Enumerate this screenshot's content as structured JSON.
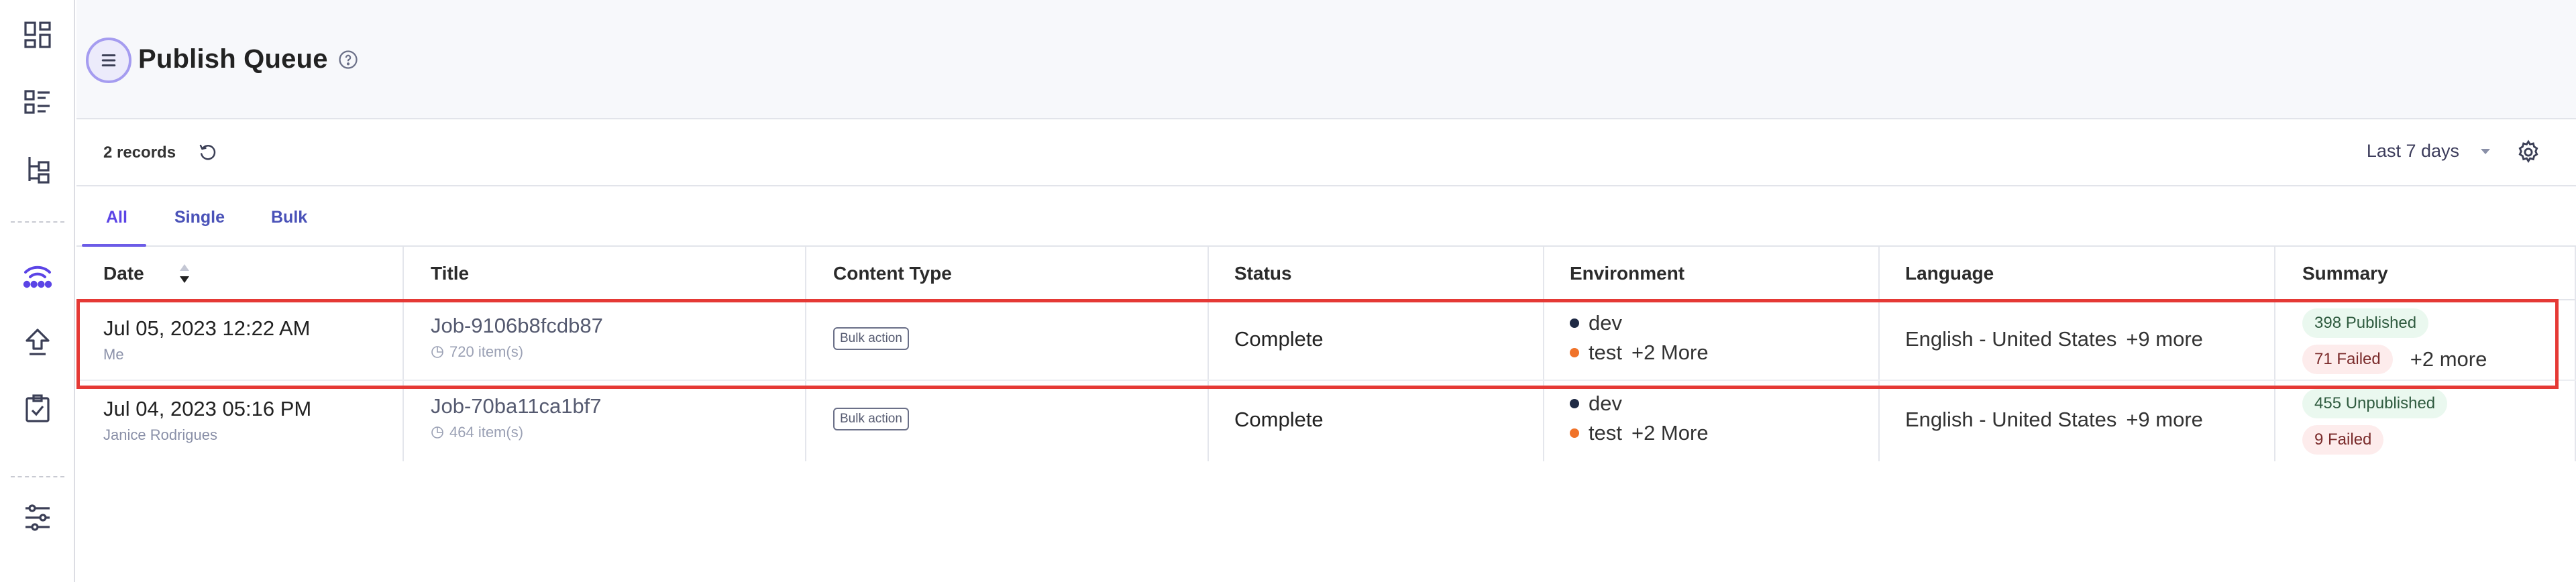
{
  "header": {
    "title": "Publish Queue"
  },
  "toolbar": {
    "records": "2 records",
    "date_filter": "Last 7 days"
  },
  "tabs": [
    {
      "label": "All",
      "active": true
    },
    {
      "label": "Single",
      "active": false
    },
    {
      "label": "Bulk",
      "active": false
    }
  ],
  "table": {
    "columns": [
      "Date",
      "Title",
      "Content Type",
      "Status",
      "Environment",
      "Language",
      "Summary"
    ],
    "rows": [
      {
        "date": "Jul 05, 2023 12:22 AM",
        "user": "Me",
        "title": "Job-9106b8fcdb87",
        "items": "720 item(s)",
        "content_type": "Bulk action",
        "status": "Complete",
        "env1": "dev",
        "env2": "test",
        "env_more": "+2 More",
        "language": "English - United States",
        "language_more": "+9 more",
        "summary1": "398 Published",
        "summary2": "71 Failed",
        "summary_more": "+2 more"
      },
      {
        "date": "Jul 04, 2023 05:16 PM",
        "user": "Janice Rodrigues",
        "title": "Job-70ba11ca1bf7",
        "items": "464 item(s)",
        "content_type": "Bulk action",
        "status": "Complete",
        "env1": "dev",
        "env2": "test",
        "env_more": "+2 More",
        "language": "English - United States",
        "language_more": "+9 more",
        "summary1": "455 Unpublished",
        "summary2": "9 Failed"
      }
    ]
  },
  "colors": {
    "accent": "#6c5ce7",
    "env_dev_dot": "#1f2a44",
    "env_test_dot": "#f0732a",
    "highlight": "#e53935"
  },
  "icons": [
    "dashboard-icon",
    "list-icon",
    "hierarchy-icon",
    "publish-queue-icon",
    "upload-icon",
    "tasks-icon",
    "settings-sliders-icon",
    "menu-icon",
    "help-icon",
    "refresh-icon",
    "caret-down-icon",
    "gear-icon",
    "sort-icon"
  ]
}
